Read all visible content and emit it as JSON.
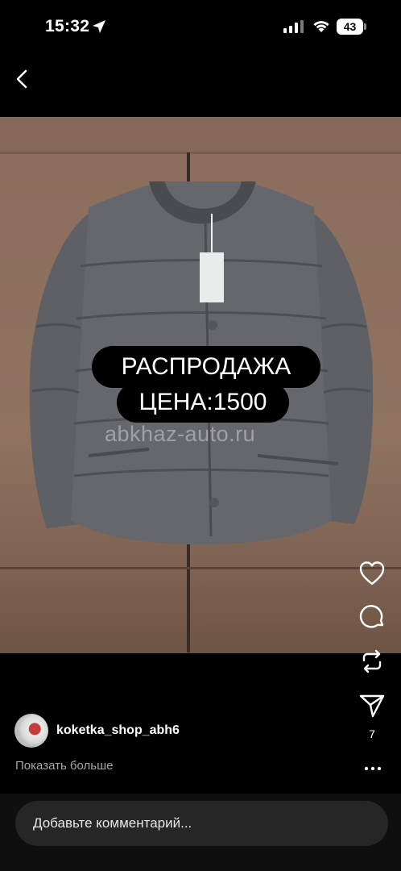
{
  "status_bar": {
    "time": "15:32",
    "battery": "43"
  },
  "media": {
    "promo_line1": "РАСПРОДАЖА",
    "promo_line2": "ЦЕНА:1500",
    "watermark": "abkhaz-auto.ru"
  },
  "actions": {
    "like_icon": "heart-icon",
    "comment_icon": "comment-icon",
    "repost_icon": "repost-icon",
    "share_icon": "send-icon",
    "share_count": "7"
  },
  "post": {
    "username": "koketka_shop_abh6",
    "show_more": "Показать больше"
  },
  "comment": {
    "placeholder": "Добавьте комментарий..."
  },
  "colors": {
    "background": "#000000",
    "input_bg": "#262626",
    "muted_text": "#a8a8a8"
  }
}
